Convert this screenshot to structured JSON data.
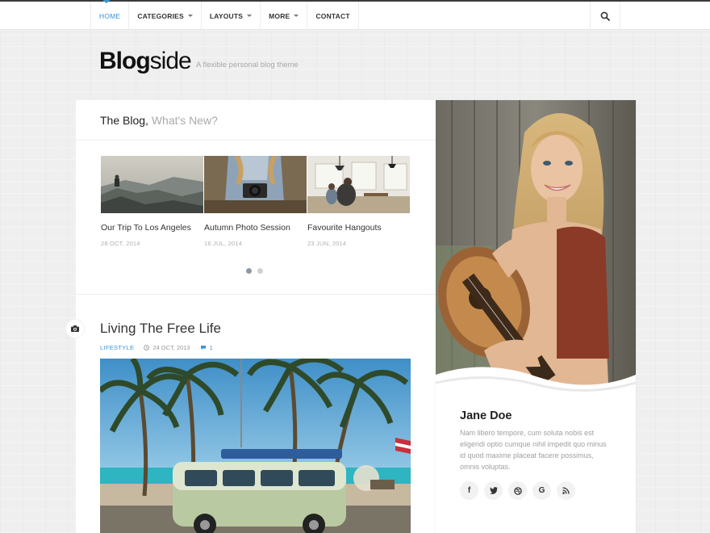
{
  "nav": {
    "items": [
      {
        "label": "HOME",
        "active": true
      },
      {
        "label": "CATEGORIES",
        "dropdown": true
      },
      {
        "label": "LAYOUTS",
        "dropdown": true
      },
      {
        "label": "MORE",
        "dropdown": true
      },
      {
        "label": "CONTACT"
      }
    ],
    "search_icon": "search-icon",
    "accent_color": "#3a93d6"
  },
  "brand": {
    "logo_bold": "Blog",
    "logo_light": "side",
    "tagline": "A flexible personal blog theme"
  },
  "blog_section": {
    "title": "The Blog,",
    "subtitle": "What's New?"
  },
  "slider": {
    "items": [
      {
        "title": "Our Trip To Los Angeles",
        "date": "28 OCT, 2014"
      },
      {
        "title": "Autumn Photo Session",
        "date": "16 JUL, 2014"
      },
      {
        "title": "Favourite Hangouts",
        "date": "23 JUN, 2014"
      }
    ],
    "pages": 2,
    "active_page": 1
  },
  "post": {
    "type_icon": "camera-icon",
    "title": "Living The Free Life",
    "category": "LIFESTYLE",
    "date": "24 OCT, 2013",
    "comments": "1"
  },
  "profile": {
    "name": "Jane Doe",
    "bio": "Nam libero tempore, cum soluta nobis est eligendi optio cumque nihil impedit quo minus id quod maxime placeat facere possimus, omnis voluptas.",
    "socials": [
      {
        "icon": "facebook-icon",
        "glyph": "f"
      },
      {
        "icon": "twitter-icon",
        "glyph": ""
      },
      {
        "icon": "dribbble-icon",
        "glyph": ""
      },
      {
        "icon": "google-icon",
        "glyph": "G"
      },
      {
        "icon": "rss-icon",
        "glyph": ""
      }
    ]
  }
}
